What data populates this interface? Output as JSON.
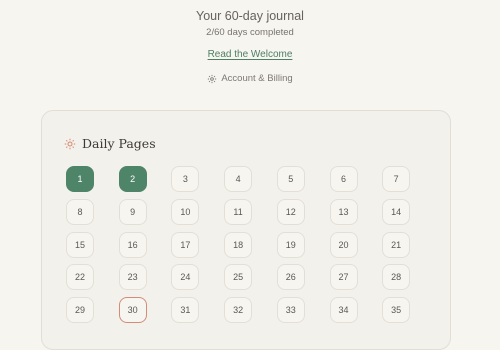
{
  "header": {
    "journal_title": "Your 60-day journal",
    "progress_text": "2/60 days completed",
    "welcome_link": "Read the Welcome",
    "account_link": "Account & Billing"
  },
  "daily_pages": {
    "title": "Daily Pages",
    "completed_days": [
      1,
      2
    ],
    "today": 30,
    "days": [
      "1",
      "2",
      "3",
      "4",
      "5",
      "6",
      "7",
      "8",
      "9",
      "10",
      "11",
      "12",
      "13",
      "14",
      "15",
      "16",
      "17",
      "18",
      "19",
      "20",
      "21",
      "22",
      "23",
      "24",
      "25",
      "26",
      "27",
      "28",
      "29",
      "30",
      "31",
      "32",
      "33",
      "34",
      "35"
    ]
  },
  "colors": {
    "accent_green": "#4e8468",
    "link_green": "#4e7f64",
    "today_outline": "#d38c79",
    "sun_icon": "#d6866f"
  },
  "icons": {
    "account": "gear-icon",
    "daily_pages": "sun-icon"
  }
}
